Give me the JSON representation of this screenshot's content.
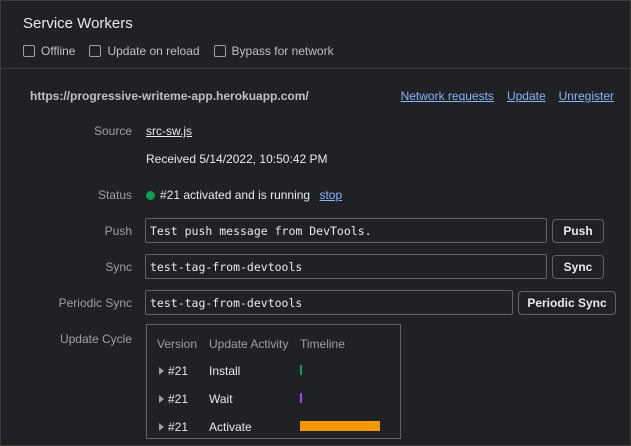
{
  "panel": {
    "title": "Service Workers",
    "options": [
      {
        "label": "Offline",
        "checked": false
      },
      {
        "label": "Update on reload",
        "checked": false
      },
      {
        "label": "Bypass for network",
        "checked": false
      }
    ]
  },
  "worker": {
    "url": "https://progressive-writeme-app.herokuapp.com/",
    "actions": [
      "Network requests",
      "Update",
      "Unregister"
    ],
    "source_label": "Source",
    "source_file": "src-sw.js",
    "received": "Received 5/14/2022, 10:50:42 PM",
    "status_label": "Status",
    "status_text": "#21 activated and is running",
    "status_color": "#0f9d58",
    "stop_label": "stop",
    "push_label": "Push",
    "push_value": "Test push message from DevTools.",
    "push_button": "Push",
    "sync_label": "Sync",
    "sync_value": "test-tag-from-devtools",
    "sync_button": "Sync",
    "periodic_label": "Periodic Sync",
    "periodic_value": "test-tag-from-devtools",
    "periodic_button": "Periodic Sync",
    "cycle_label": "Update Cycle"
  },
  "update_cycle": {
    "headers": [
      "Version",
      "Update Activity",
      "Timeline"
    ],
    "rows": [
      {
        "version": "#21",
        "activity": "Install",
        "color": "#0f9d58"
      },
      {
        "version": "#21",
        "activity": "Wait",
        "color": "#a142f4"
      },
      {
        "version": "#21",
        "activity": "Activate",
        "color": "#f29900"
      }
    ]
  }
}
